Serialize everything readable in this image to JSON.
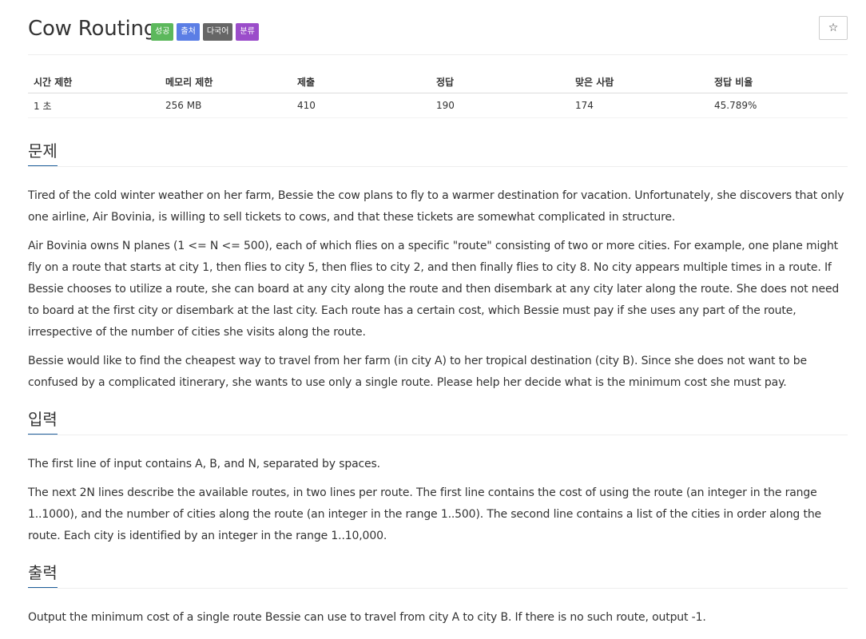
{
  "problem": {
    "title": "Cow Routing",
    "labels": [
      {
        "text": "성공",
        "color": "#5cb85c"
      },
      {
        "text": "출처",
        "color": "#5b7ee5"
      },
      {
        "text": "다국어",
        "color": "#666666"
      },
      {
        "text": "분류",
        "color": "#9b4dca"
      }
    ],
    "star_icon": "☆"
  },
  "info_table": {
    "headers": [
      "시간 제한",
      "메모리 제한",
      "제출",
      "정답",
      "맞은 사람",
      "정답 비율"
    ],
    "values": [
      "1 초",
      "256 MB",
      "410",
      "190",
      "174",
      "45.789%"
    ]
  },
  "sections": {
    "description": {
      "title": "문제",
      "paragraphs": [
        "Tired of the cold winter weather on her farm, Bessie the cow plans to fly to a warmer destination for vacation.  Unfortunately, she discovers that only one airline, Air Bovinia, is willing to sell tickets to cows, and that these tickets are somewhat complicated in structure.",
        "Air Bovinia owns N planes (1 <= N <= 500), each of which flies on a specific \"route\" consisting of two or more cities.  For example, one plane might fly on a route that starts at city 1, then flies to city 5, then flies to city 2, and then finally flies to city 8.  No city appears multiple times in a route.  If Bessie chooses to utilize a route, she can board at any city along the route and then disembark at any city later along the route.  She does not need to board at the first city or disembark at the last city.  Each route has a certain cost, which Bessie must pay if she uses any part of the route, irrespective of the number of cities she visits along the route.",
        "Bessie would like to find the cheapest way to travel from her farm (in city A) to her tropical destination (city B). Since she does not want to be confused by a complicated itinerary, she wants to use only a single route.  Please help her decide what is the minimum cost she must pay."
      ]
    },
    "input": {
      "title": "입력",
      "paragraphs": [
        "The first line of input contains A, B, and N, separated by spaces.",
        "The next 2N lines describe the available routes, in two lines per route. The first line contains the cost of using the route (an integer in the range 1..1000), and the number of cities along the route (an integer in the range 1..500).  The second line contains a list of the cities in order along the route.  Each city is identified by an integer in the range 1..10,000."
      ]
    },
    "output": {
      "title": "출력",
      "paragraphs": [
        "Output the minimum cost of a single route Bessie can use to travel from city A to city B.  If there is no such route, output -1."
      ]
    }
  }
}
